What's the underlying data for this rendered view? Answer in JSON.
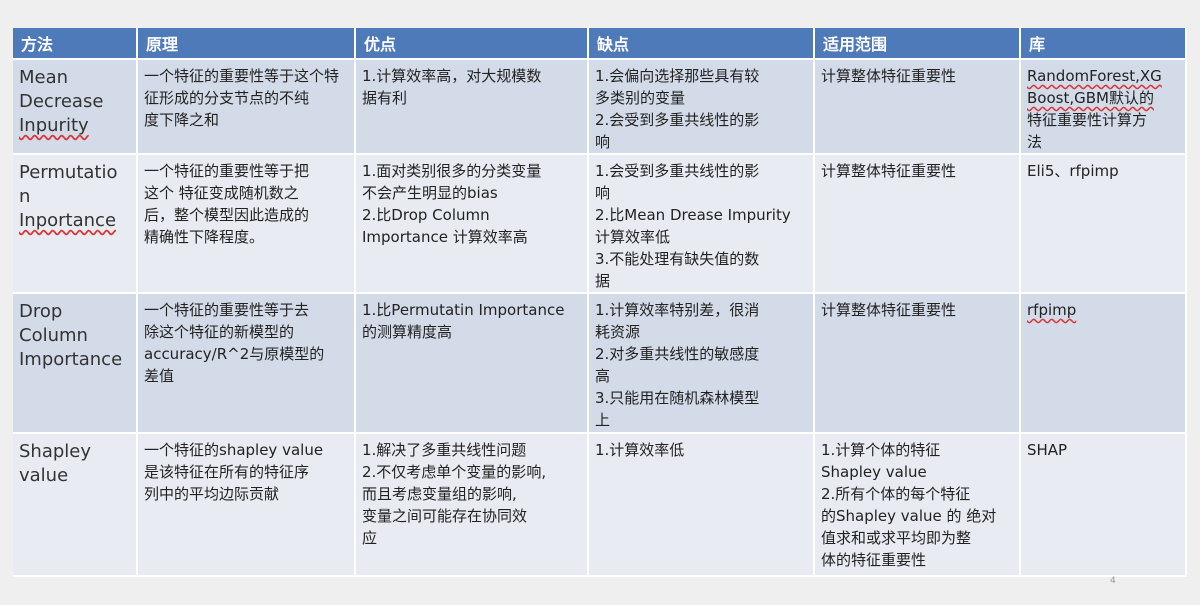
{
  "headers": [
    "方法",
    "原理",
    "优点",
    "缺点",
    "适用范围",
    "库"
  ],
  "rows": [
    {
      "method": [
        "Mean",
        "Decrease",
        "Inpurity"
      ],
      "principle": [
        "一个特征的重要性等于这个特",
        "征形成的分支节点的不纯",
        "度下降之和"
      ],
      "pros": [
        "1.计算效率高，对大规模数",
        "据有利"
      ],
      "cons": [
        "1.会偏向选择那些具有较",
        "多类别的变量",
        "2.会受到多重共线性的影",
        "响"
      ],
      "scope": [
        "计算整体特征重要性"
      ],
      "library": [
        "RandomForest,XG",
        "Boost,GBM默认的",
        "特征重要性计算方",
        "法"
      ]
    },
    {
      "method": [
        "Permutatio",
        "n",
        "Inportance"
      ],
      "principle": [
        "一个特征的重要性等于把",
        "这个 特征变成随机数之",
        "后，整个模型因此造成的",
        "精确性下降程度。"
      ],
      "pros": [
        "1.面对类别很多的分类变量",
        "不会产生明显的bias",
        "2.比Drop Column",
        "Importance 计算效率高"
      ],
      "cons": [
        "1.会受到多重共线性的影",
        "响",
        "2.比Mean Drease Impurity",
        "计算效率低",
        "3.不能处理有缺失值的数",
        "据"
      ],
      "scope": [
        "计算整体特征重要性"
      ],
      "library": [
        "Eli5、rfpimp"
      ]
    },
    {
      "method": [
        "Drop",
        "Column",
        "Importance"
      ],
      "principle": [
        "一个特征的重要性等于去",
        "除这个特征的新模型的",
        "accuracy/R^2与原模型的",
        "差值"
      ],
      "pros": [
        "1.比Permutatin Importance",
        "的测算精度高"
      ],
      "cons": [
        "1.计算效率特别差，很消",
        "耗资源",
        "2.对多重共线性的敏感度",
        "高",
        "3.只能用在随机森林模型",
        "上"
      ],
      "scope": [
        "计算整体特征重要性"
      ],
      "library": [
        "rfpimp"
      ]
    },
    {
      "method": [
        "Shapley",
        "value"
      ],
      "principle": [
        "一个特征的shapley value",
        "是该特征在所有的特征序",
        "列中的平均边际贡献"
      ],
      "pros": [
        "1.解决了多重共线性问题",
        "2.不仅考虑单个变量的影响,",
        "而且考虑变量组的影响,",
        "变量之间可能存在协同效",
        "应"
      ],
      "cons": [
        "1.计算效率低"
      ],
      "scope": [
        "1.计算个体的特征",
        "Shapley value",
        "2.所有个体的每个特征",
        "的Shapley value 的 绝对",
        "值求和或求平均即为整",
        "体的特征重要性"
      ],
      "library": [
        "SHAP"
      ]
    }
  ],
  "page_number": "4",
  "colors": {
    "header_bg": "#4f7ab9",
    "row_dark": "#d3dbe9",
    "row_light": "#e8ebf1"
  }
}
